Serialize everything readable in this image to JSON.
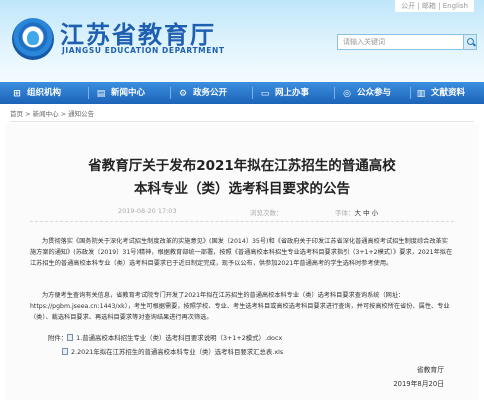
{
  "header": {
    "site_title": "江苏省教育厅",
    "site_subtitle": "JIANGSU EDUCATION DEPARTMENT",
    "top_links": "公开 | 邮箱 | English",
    "search_placeholder": "请输入关键词"
  },
  "nav": [
    {
      "label": "组织机构",
      "icon": "org-icon"
    },
    {
      "label": "新闻中心",
      "icon": "news-icon"
    },
    {
      "label": "政务公开",
      "icon": "gov-icon"
    },
    {
      "label": "网上办事",
      "icon": "computer-icon"
    },
    {
      "label": "公众参与",
      "icon": "chat-icon"
    },
    {
      "label": "文献资料",
      "icon": "book-icon"
    }
  ],
  "breadcrumb": "首页 > 新闻中心 > 通知公告",
  "article": {
    "title_line1": "省教育厅关于发布2021年拟在江苏招生的普通高校",
    "title_line2": "本科专业（类）选考科目要求的公告",
    "date": "2019-08-20 17:03",
    "views": "浏览次数：",
    "font_size_label": "字体：",
    "font_sizes": "大 中 小",
    "paragraph1": "为贯彻落实《国务院关于深化考试招生制度改革的实施意见》(国发〔2014〕35号)和《省政府关于印发江苏省深化普通高校考试招生制度综合改革实施方案的通知》(苏政发〔2019〕31号)精神，根据教育部统一部署，按照《普通高校本科招生专业选考科目要求指引（3+1+2模式）》要求，2021年拟在江苏招生的普通高校本科专业（类）选考科目要求已于近日制定完成，现予以公布，供参加2021年普通高考的学生选科时参考使用。",
    "paragraph2": "为方便考生查询有关信息，省教育考试院专门开发了2021年拟在江苏招生的普通高校本科专业（类）选考科目要求查询系统（网址：https://pgbm.jseea.cn:1443/xk），考生可根据需要，按照学校、专业、考生选考科目或高校选考科目要求进行查询，并可按高校所在省份、属性、专业（类）、裁选科目要求、再选科目要求等对查询结果进行再次筛选。",
    "attachment_label": "附件：",
    "attachment1": "1.普通高校本科招生专业（类）选考科目要求说明（3+1+2模式）.docx",
    "attachment2": "2.2021年拟在江苏招生的普通高校本科专业（类）选考科目要求汇总表.xls",
    "signature": "省教育厅",
    "sign_date": "2019年8月20日"
  }
}
